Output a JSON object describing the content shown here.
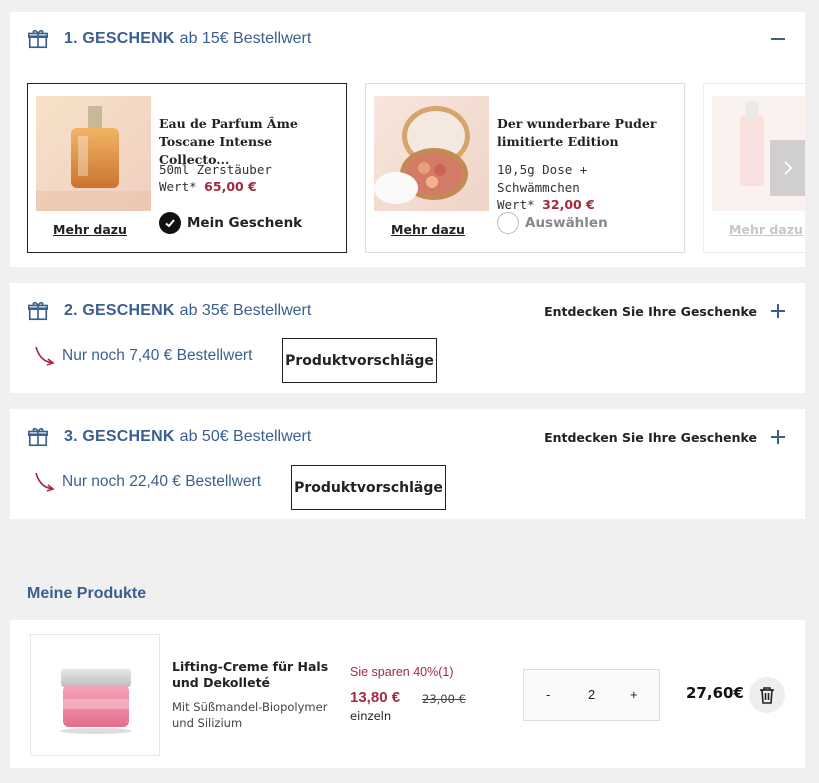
{
  "gift_tiers": [
    {
      "number": "1. GESCHENK",
      "condition": "ab 15€ Bestellwert",
      "products": [
        {
          "title": "Eau de Parfum Âme Toscane Intense Collecto...",
          "desc": "50ml Zerstäuber",
          "worth_label": "Wert*",
          "worth_value": "65,00 €",
          "more": "Mehr dazu",
          "choice": "Mein Geschenk",
          "selected": true
        },
        {
          "title": "Der wunderbare Puder limitierte Edition",
          "desc": "10,5g Dose + Schwämmchen",
          "worth_label": "Wert*",
          "worth_value": "32,00 €",
          "more": "Mehr dazu",
          "choice": "Auswählen",
          "selected": false
        },
        {
          "more": "Mehr dazu"
        }
      ]
    },
    {
      "number": "2. GESCHENK",
      "condition": "ab 35€ Bestellwert",
      "discover": "Entdecken Sie Ihre Geschenke",
      "remaining": "Nur noch 7,40 € Bestellwert",
      "suggestions": "Produktvorschläge"
    },
    {
      "number": "3. GESCHENK",
      "condition": "ab 50€ Bestellwert",
      "discover": "Entdecken Sie Ihre Geschenke",
      "remaining": "Nur noch 22,40 € Bestellwert",
      "suggestions": "Produktvorschläge"
    }
  ],
  "my_products": {
    "title": "Meine Produkte",
    "items": [
      {
        "name": "Lifting-Creme für Hals und Dekolleté",
        "sub": "Mit Süßmandel-Biopolymer und Silizium",
        "savings": "Sie sparen 40%(1)",
        "price": "13,80 €",
        "old_price": "23,00 €",
        "unit": "einzeln",
        "qty_minus": "-",
        "qty": "2",
        "qty_plus": "+",
        "total": "27,60€"
      }
    ]
  },
  "icons": {
    "gift": "gift-icon",
    "collapse": "minus-icon",
    "expand": "plus-icon",
    "arrow": "curved-arrow-icon",
    "check": "check-circle-icon",
    "next": "chevron-right-icon",
    "delete": "trash-icon"
  },
  "colors": {
    "brand_blue": "#3a5f8f",
    "price_red": "#a32a3e"
  }
}
